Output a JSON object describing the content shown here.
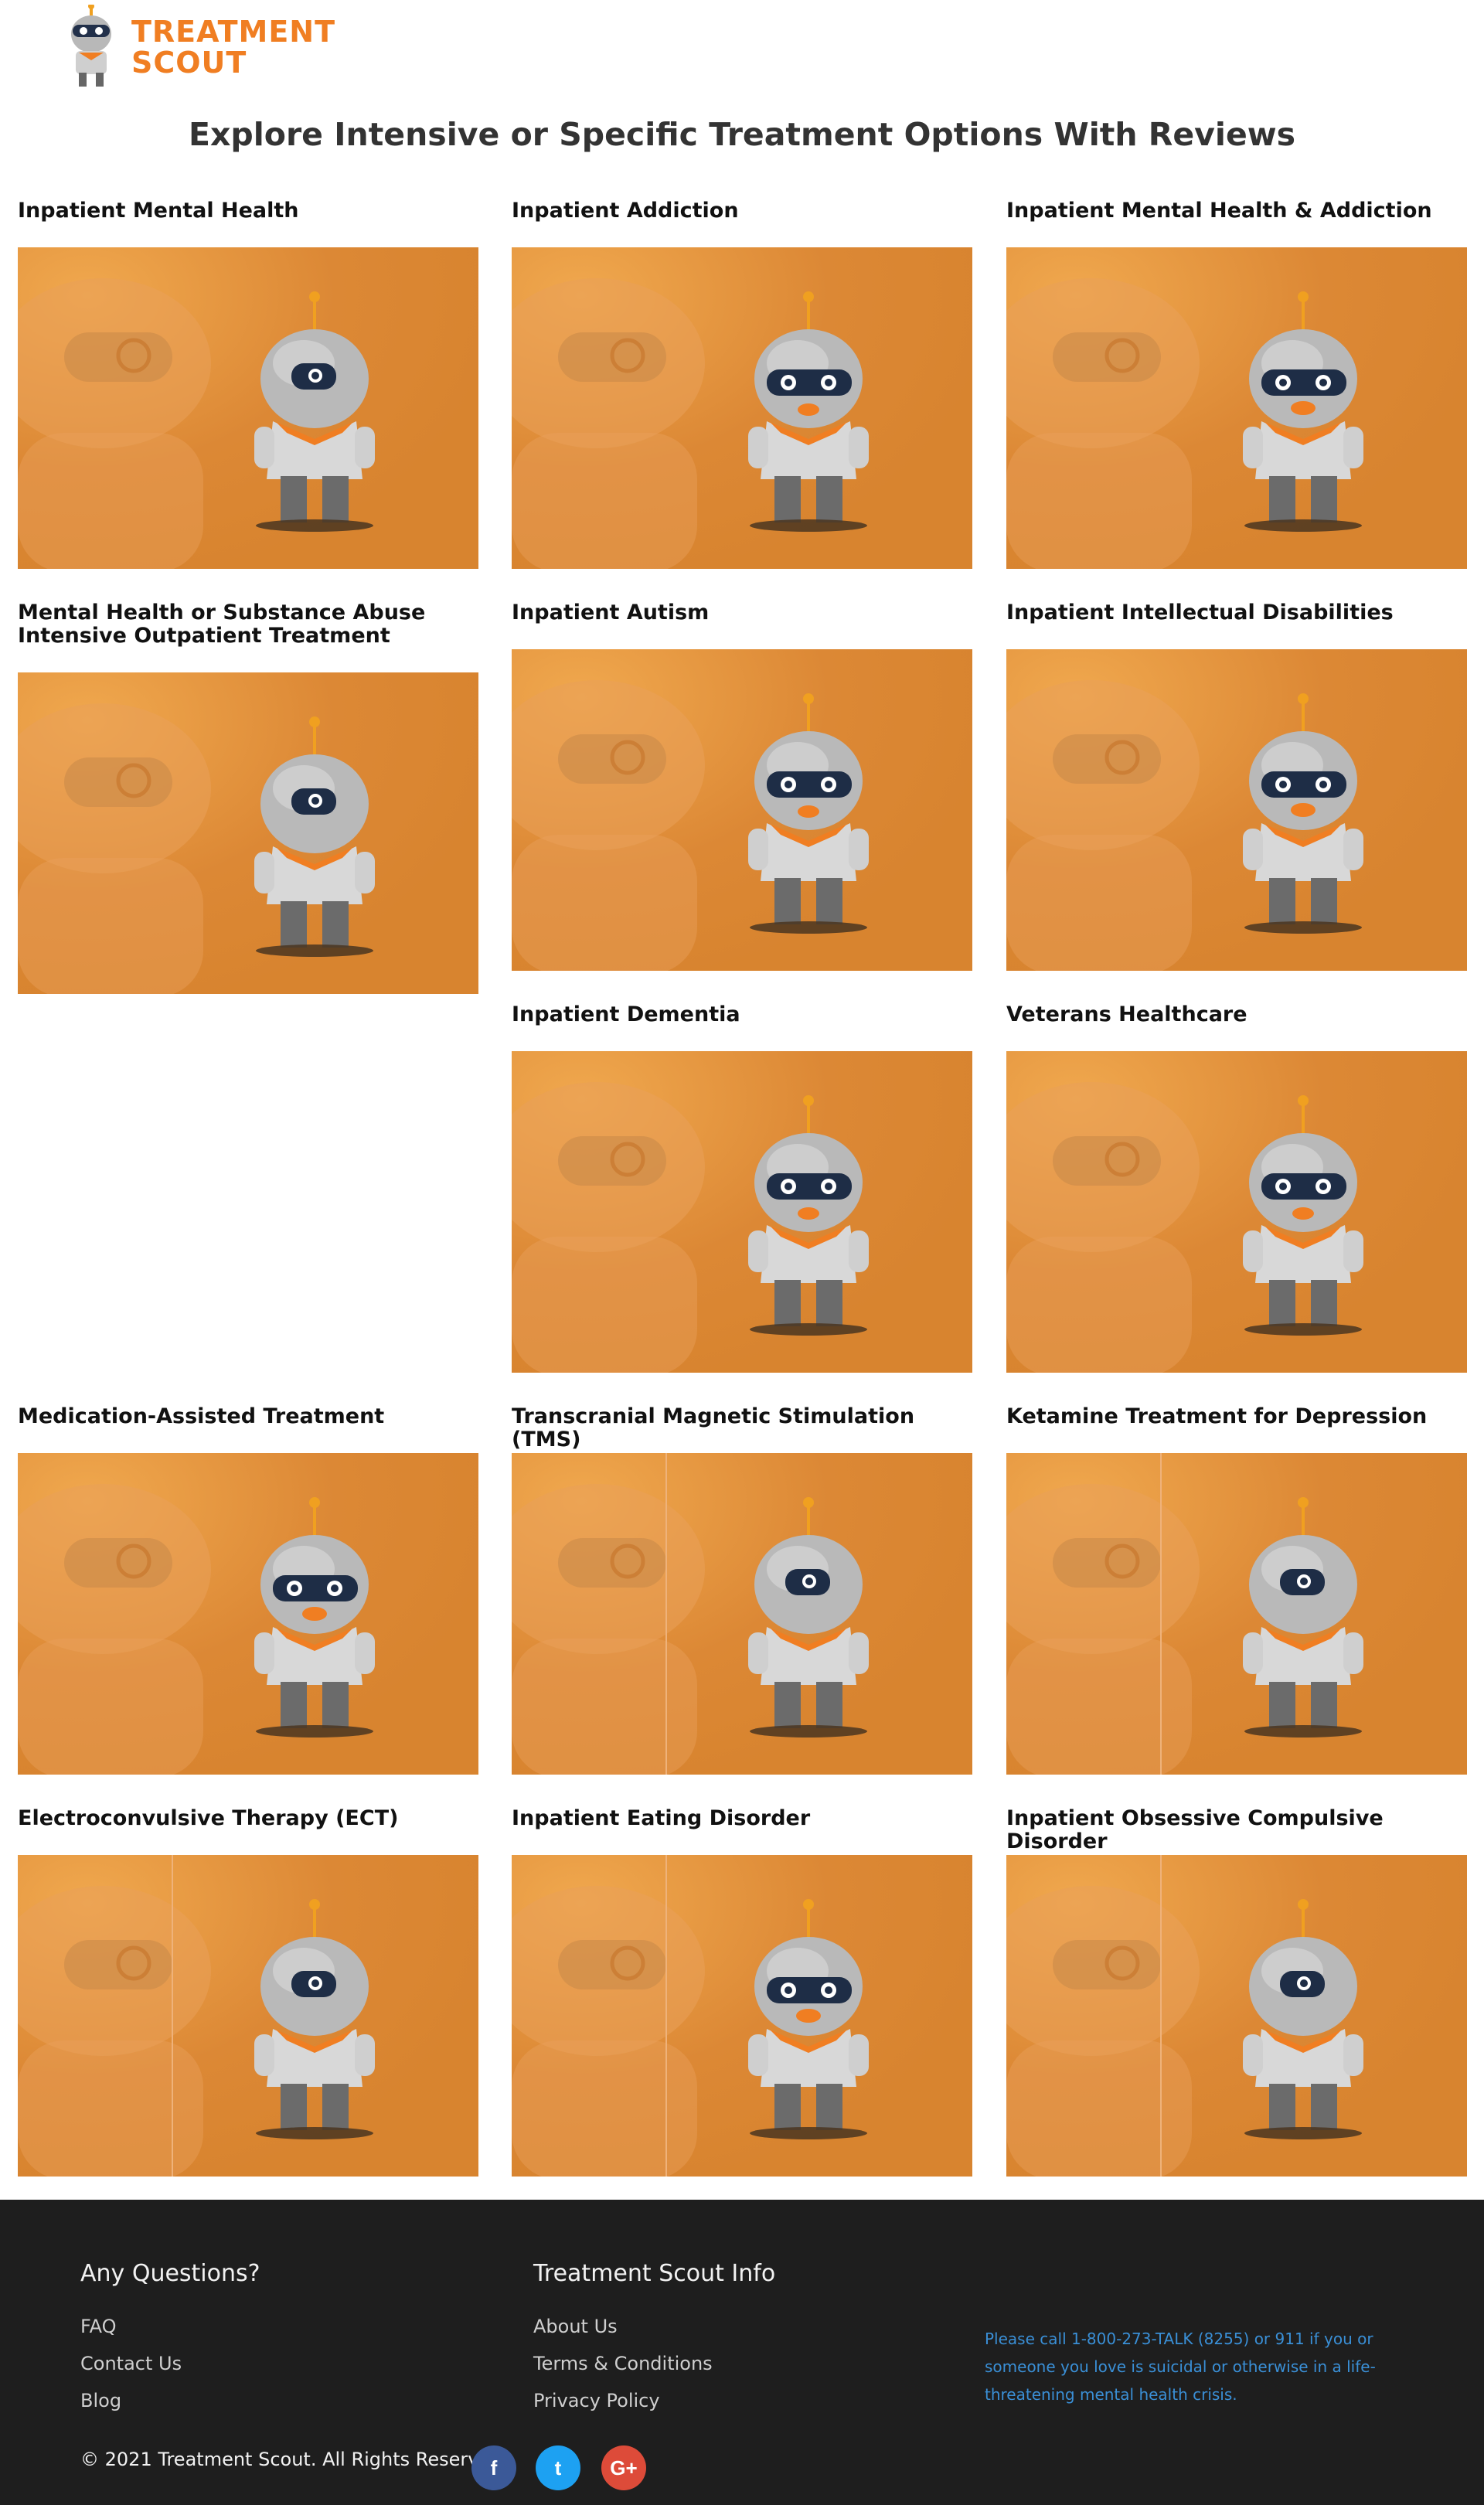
{
  "site": {
    "logo_line1": "TREATMENT",
    "logo_line2": "SCOUT",
    "brand_color": "#f07e22"
  },
  "page_title": "Explore Intensive or Specific Treatment Options With Reviews",
  "cards": [
    {
      "title": "Inpatient Mental Health"
    },
    {
      "title": "Inpatient Addiction"
    },
    {
      "title": "Inpatient Mental Health & Addiction"
    },
    {
      "title": "Mental Health or Substance Abuse Intensive Outpatient Treatment"
    },
    {
      "title": "Inpatient Autism"
    },
    {
      "title": "Inpatient Intellectual Disabilities"
    },
    {
      "title": "Inpatient Dementia"
    },
    {
      "title": "Veterans Healthcare"
    },
    {
      "title": "Medication-Assisted Treatment"
    },
    {
      "title": "Transcranial Magnetic Stimulation (TMS)"
    },
    {
      "title": "Ketamine Treatment for Depression"
    },
    {
      "title": "Electroconvulsive Therapy (ECT)"
    },
    {
      "title": "Inpatient Eating Disorder"
    },
    {
      "title": "Inpatient Obsessive Compulsive Disorder"
    }
  ],
  "footer": {
    "col1_heading": "Any Questions?",
    "col1_links": [
      "FAQ",
      "Contact Us",
      "Blog"
    ],
    "col2_heading": "Treatment Scout Info",
    "col2_links": [
      "About Us",
      "Terms & Conditions",
      "Privacy Policy"
    ],
    "crisis_text": "Please call 1-800-273-TALK (8255) or 911 if you or someone you love is suicidal or otherwise in a life-threatening mental health crisis.",
    "copyright": "© 2021 Treatment Scout. All Rights Reserved.",
    "social": [
      {
        "icon": "facebook-icon",
        "glyph": "f",
        "color": "#3b5998"
      },
      {
        "icon": "twitter-icon",
        "glyph": "t",
        "color": "#1da1f2"
      },
      {
        "icon": "google-plus-icon",
        "glyph": "G+",
        "color": "#dd4b39"
      }
    ]
  }
}
